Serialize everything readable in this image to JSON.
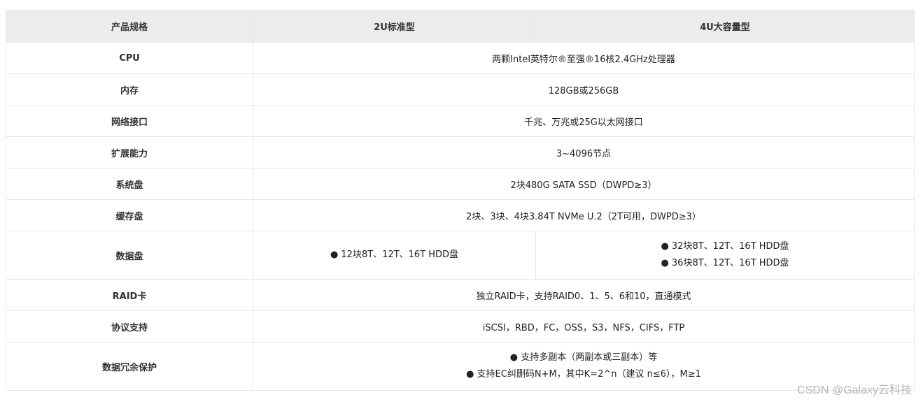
{
  "table": {
    "headers": [
      "产品规格",
      "2U标准型",
      "4U大容量型"
    ],
    "rows": {
      "cpu": {
        "label": "CPU",
        "value": "两颗Intel英特尔®至强®16核2.4GHz处理器"
      },
      "memory": {
        "label": "内存",
        "value": "128GB或256GB"
      },
      "network": {
        "label": "网络接口",
        "value": "千兆、万兆或25G以太网接口"
      },
      "scale": {
        "label": "扩展能力",
        "value": "3~4096节点"
      },
      "system_disk": {
        "label": "系统盘",
        "value": "2块480G SATA SSD（DWPD≥3）"
      },
      "cache_disk": {
        "label": "缓存盘",
        "value": "2块、3块、4块3.84T NVMe U.2（2T可用，DWPD≥3）"
      },
      "data_disk": {
        "label": "数据盘",
        "col_2u": [
          "● 12块8T、12T、16T HDD盘"
        ],
        "col_4u": [
          "● 32块8T、12T、16T HDD盘",
          "● 36块8T、12T、16T HDD盘"
        ]
      },
      "raid": {
        "label": "RAID卡",
        "value": "独立RAID卡，支持RAID0、1、5、6和10，直通模式"
      },
      "protocol": {
        "label": "协议支持",
        "value": "iSCSI，RBD，FC，OSS，S3，NFS，CIFS，FTP"
      },
      "redundancy": {
        "label": "数据冗余保护",
        "lines": [
          "● 支持多副本（两副本或三副本）等",
          "● 支持EC纠删码N+M，其中K=2^n（建议 n≤6），M≥1"
        ]
      }
    }
  },
  "watermark": "CSDN @Galaxy云科技"
}
